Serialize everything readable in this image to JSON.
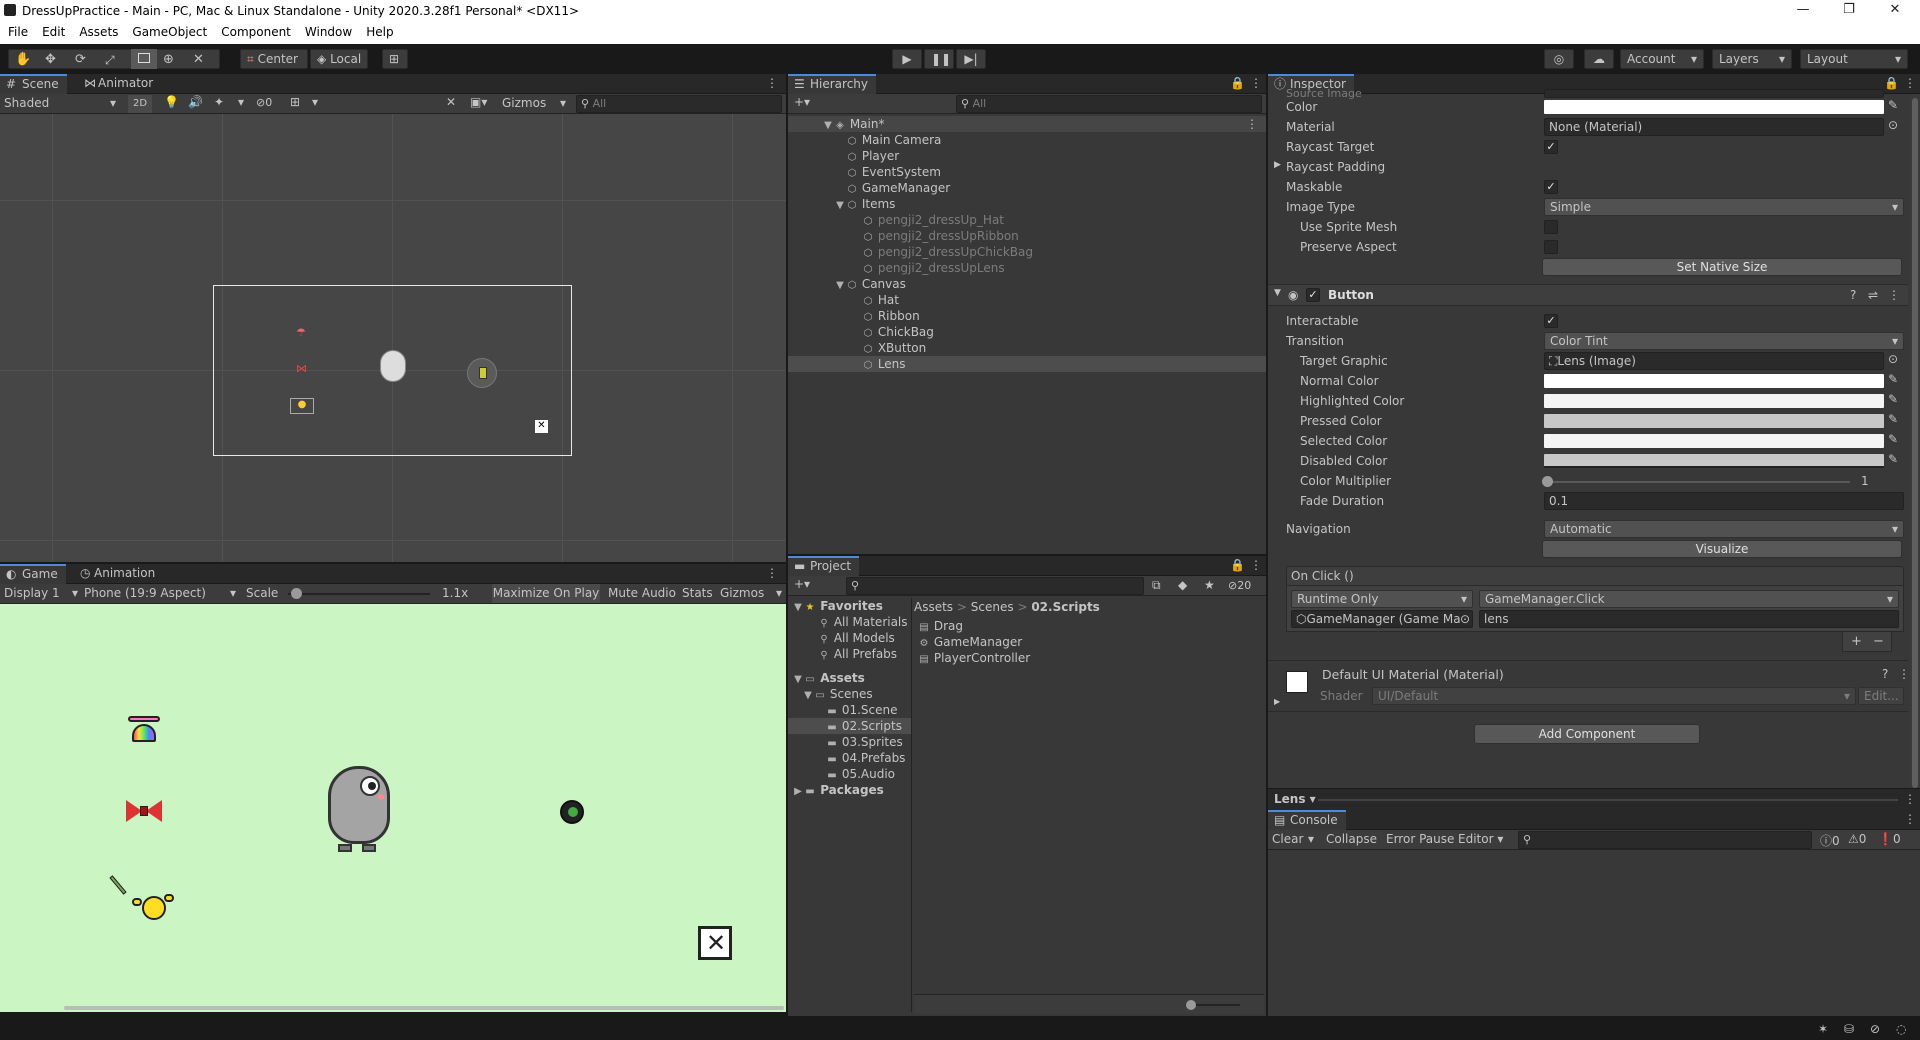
{
  "window": {
    "title": "DressUpPractice - Main - PC, Mac & Linux Standalone - Unity 2020.3.28f1 Personal* <DX11>",
    "minimize": "—",
    "maximize": "❐",
    "close": "✕"
  },
  "menu": [
    "File",
    "Edit",
    "Assets",
    "GameObject",
    "Component",
    "Window",
    "Help"
  ],
  "toolbar": {
    "pivot": "Center",
    "space": "Local",
    "account": "Account",
    "layers": "Layers",
    "layout": "Layout"
  },
  "scene": {
    "tabs": [
      "Scene",
      "Animator"
    ],
    "shading": "Shaded",
    "mode_2d": "2D",
    "hidden_count": "0",
    "gizmos": "Gizmos",
    "search_placeholder": "All"
  },
  "game": {
    "tabs": [
      "Game",
      "Animation"
    ],
    "display": "Display 1",
    "aspect": "Phone (19:9 Aspect)",
    "scale_label": "Scale",
    "scale_value": "1.1x",
    "maximize": "Maximize On Play",
    "mute": "Mute Audio",
    "stats": "Stats",
    "gizmos": "Gizmos",
    "bg_color": "#ccf5c4"
  },
  "hierarchy": {
    "tab": "Hierarchy",
    "search_placeholder": "All",
    "root": "Main*",
    "items": [
      {
        "label": "Main Camera",
        "dim": false
      },
      {
        "label": "Player",
        "dim": false
      },
      {
        "label": "EventSystem",
        "dim": false
      },
      {
        "label": "GameManager",
        "dim": false
      },
      {
        "label": "Items",
        "dim": false
      },
      {
        "label": "pengji2_dressUp_Hat",
        "dim": true
      },
      {
        "label": "pengji2_dressUpRibbon",
        "dim": true
      },
      {
        "label": "pengji2_dressUpChickBag",
        "dim": true
      },
      {
        "label": "pengji2_dressUpLens",
        "dim": true
      },
      {
        "label": "Canvas",
        "dim": false
      },
      {
        "label": "Hat",
        "dim": false
      },
      {
        "label": "Ribbon",
        "dim": false
      },
      {
        "label": "ChickBag",
        "dim": false
      },
      {
        "label": "XButton",
        "dim": false
      },
      {
        "label": "Lens",
        "dim": false
      }
    ]
  },
  "project": {
    "tab": "Project",
    "hidden_count": "20",
    "favorites_label": "Favorites",
    "favorites": [
      "All Materials",
      "All Models",
      "All Prefabs"
    ],
    "assets_label": "Assets",
    "scenes_label": "Scenes",
    "folders": [
      "01.Scene",
      "02.Scripts",
      "03.Sprites",
      "04.Prefabs",
      "05.Audio"
    ],
    "packages_label": "Packages",
    "breadcrumb": [
      "Assets",
      "Scenes",
      "02.Scripts"
    ],
    "files": [
      "Drag",
      "GameManager",
      "PlayerController"
    ]
  },
  "inspector": {
    "tab": "Inspector",
    "cut_label": "Source Image",
    "image_props": {
      "color_label": "Color",
      "material_label": "Material",
      "material_value": "None (Material)",
      "raycast_target_label": "Raycast Target",
      "raycast_padding_label": "Raycast Padding",
      "maskable_label": "Maskable",
      "image_type_label": "Image Type",
      "image_type_value": "Simple",
      "use_sprite_mesh_label": "Use Sprite Mesh",
      "preserve_aspect_label": "Preserve Aspect",
      "set_native_size": "Set Native Size"
    },
    "button": {
      "header": "Button",
      "interactable_label": "Interactable",
      "transition_label": "Transition",
      "transition_value": "Color Tint",
      "target_graphic_label": "Target Graphic",
      "target_graphic_value": "Lens (Image)",
      "normal_color_label": "Normal Color",
      "highlighted_color_label": "Highlighted Color",
      "pressed_color_label": "Pressed Color",
      "selected_color_label": "Selected Color",
      "disabled_color_label": "Disabled Color",
      "color_multiplier_label": "Color Multiplier",
      "color_multiplier_value": "1",
      "fade_duration_label": "Fade Duration",
      "fade_duration_value": "0.1",
      "navigation_label": "Navigation",
      "navigation_value": "Automatic",
      "visualize": "Visualize",
      "onclick_label": "On Click ()",
      "runtime": "Runtime Only",
      "function": "GameManager.Click",
      "target_object": "GameManager (Game Ma",
      "argument": "lens",
      "add": "+",
      "remove": "−"
    },
    "material": {
      "name": "Default UI Material (Material)",
      "shader_label": "Shader",
      "shader_value": "UI/Default",
      "edit": "Edit..."
    },
    "add_component": "Add Component",
    "footer_object": "Lens"
  },
  "console": {
    "tab": "Console",
    "clear": "Clear",
    "collapse": "Collapse",
    "error_pause": "Error Pause",
    "editor": "Editor",
    "log_count": "0",
    "warn_count": "0",
    "error_count": "0"
  }
}
